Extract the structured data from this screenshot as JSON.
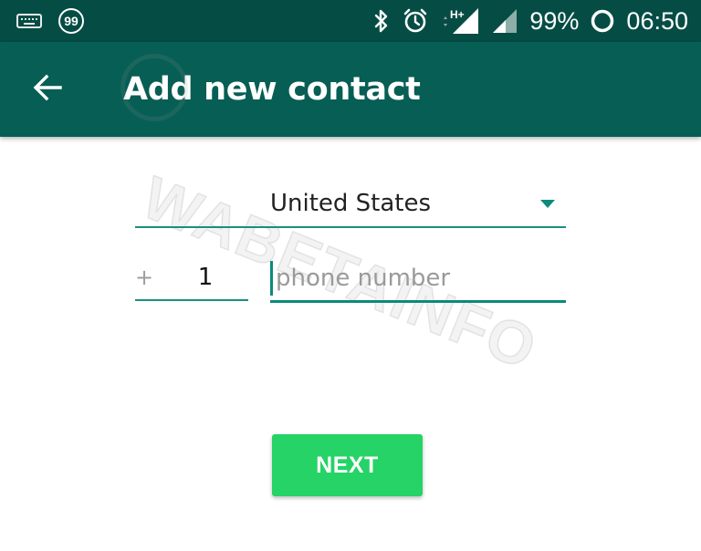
{
  "status_bar": {
    "notification_count": "99",
    "battery_percent": "99%",
    "time": "06:50",
    "network_label": "H+",
    "icons": [
      "keyboard-icon",
      "notification-count-icon",
      "bluetooth-icon",
      "alarm-icon",
      "signal-h-plus-icon",
      "signal-icon",
      "battery-ring-icon"
    ]
  },
  "app_bar": {
    "title": "Add new contact",
    "back_icon": "arrow-left-icon",
    "background": "#075e54"
  },
  "form": {
    "country": "United States",
    "country_code_prefix": "+",
    "country_code": "1",
    "phone_number_value": "",
    "phone_placeholder": "phone number",
    "accent_color": "#0c8a7a"
  },
  "actions": {
    "next_label": "NEXT",
    "next_color": "#25d366"
  },
  "watermark": {
    "text": "WABETAINFO"
  }
}
